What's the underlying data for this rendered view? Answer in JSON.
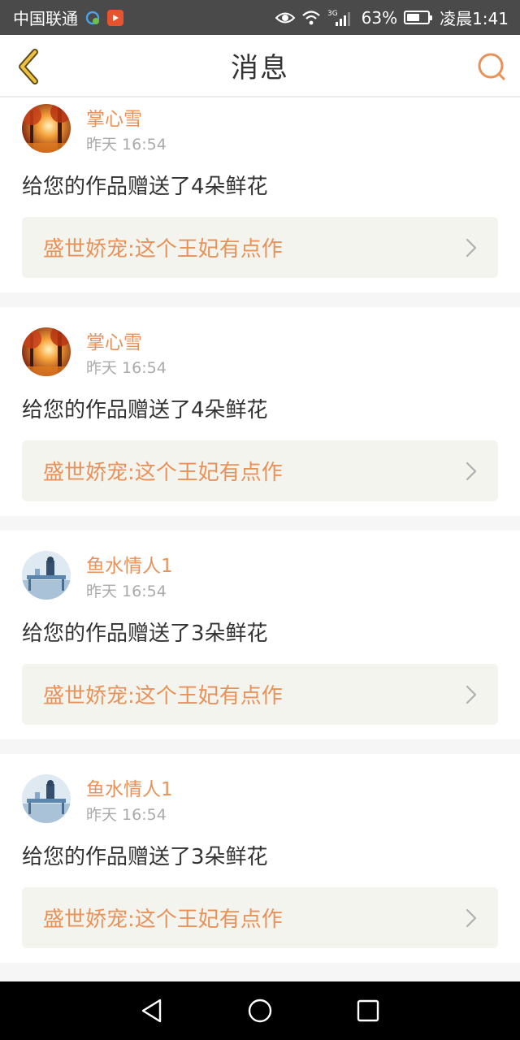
{
  "status": {
    "carrier": "中国联通",
    "network": "3G",
    "battery": "63%",
    "battery_level": 0.63,
    "time": "凌晨1:41"
  },
  "header": {
    "title": "消息",
    "back_icon": "chevron-left-icon",
    "search_icon": "search-icon"
  },
  "colors": {
    "accent": "#e8925a",
    "back_icon": "#d9a928",
    "link_bg": "#f4f4ee"
  },
  "messages": [
    {
      "username": "掌心雪",
      "time": "昨天  16:54",
      "text": "给您的作品赠送了4朵鲜花",
      "work": "盛世娇宠:这个王妃有点作",
      "avatar": "autumn-forest-avatar"
    },
    {
      "username": "掌心雪",
      "time": "昨天  16:54",
      "text": "给您的作品赠送了4朵鲜花",
      "work": "盛世娇宠:这个王妃有点作",
      "avatar": "autumn-forest-avatar"
    },
    {
      "username": "鱼水情人1",
      "time": "昨天  16:54",
      "text": "给您的作品赠送了3朵鲜花",
      "work": "盛世娇宠:这个王妃有点作",
      "avatar": "blue-room-avatar"
    },
    {
      "username": "鱼水情人1",
      "time": "昨天  16:54",
      "text": "给您的作品赠送了3朵鲜花",
      "work": "盛世娇宠:这个王妃有点作",
      "avatar": "blue-room-avatar"
    }
  ],
  "nav": {
    "back": "nav-back-icon",
    "home": "nav-home-icon",
    "recents": "nav-recents-icon"
  }
}
